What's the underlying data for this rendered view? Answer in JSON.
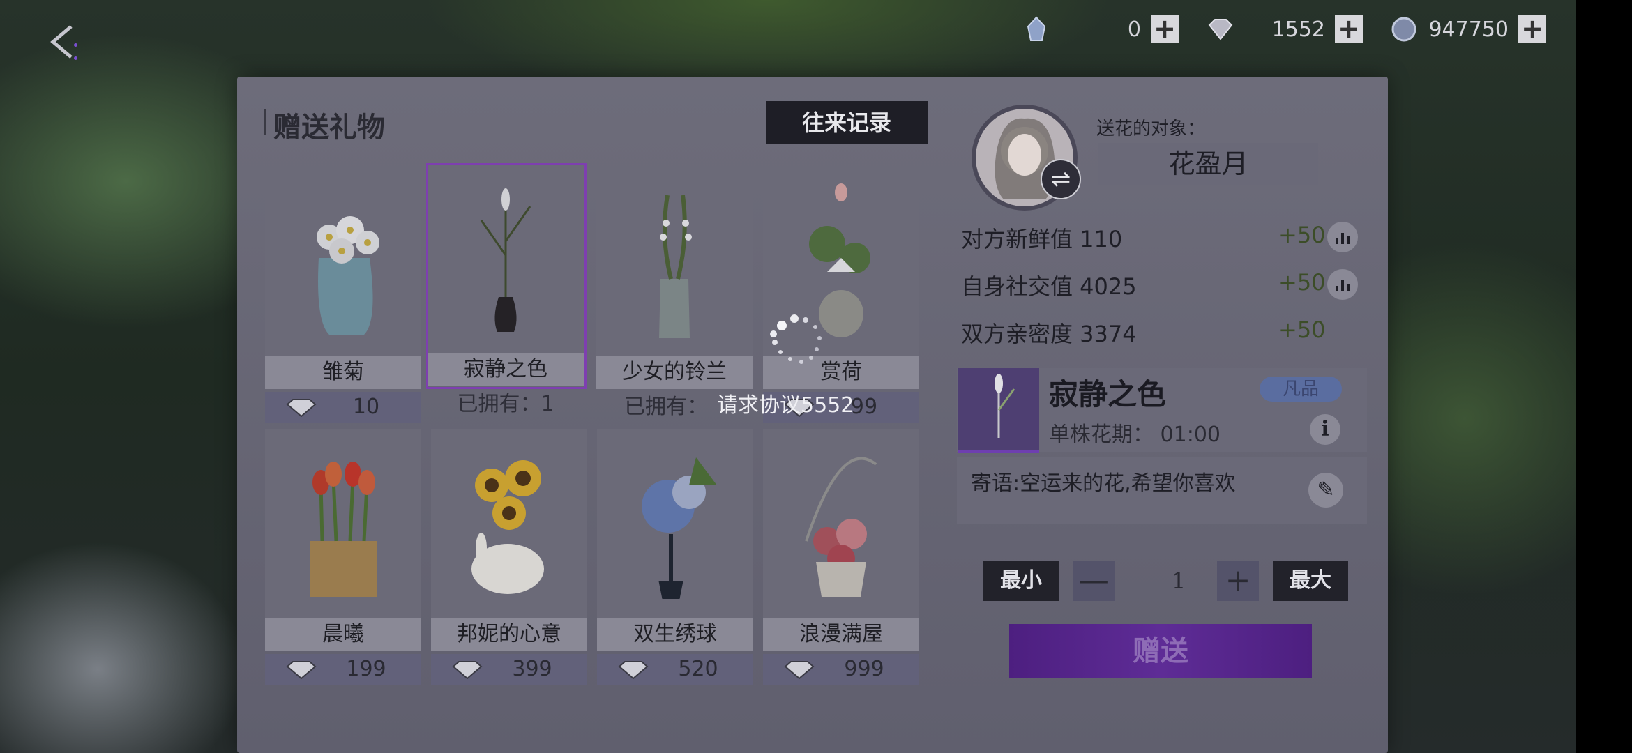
{
  "top_bar": {
    "currencies": [
      {
        "icon": "crystal-icon",
        "value": "0"
      },
      {
        "icon": "diamond-icon",
        "value": "1552"
      },
      {
        "icon": "coin-icon",
        "value": "947750"
      }
    ],
    "plus_label": "+"
  },
  "gift_panel": {
    "title": "赠送礼物",
    "history_button": "往来记录",
    "flowers": [
      {
        "name": "雏菊",
        "price": "10",
        "owned": null
      },
      {
        "name": "寂静之色",
        "price": null,
        "owned": "已拥有：1"
      },
      {
        "name": "少女的铃兰",
        "price": null,
        "owned": "已拥有："
      },
      {
        "name": "赏荷",
        "price": "99",
        "owned": null
      },
      {
        "name": "晨曦",
        "price": "199",
        "owned": null
      },
      {
        "name": "邦妮的心意",
        "price": "399",
        "owned": null
      },
      {
        "name": "双生绣球",
        "price": "520",
        "owned": null
      },
      {
        "name": "浪漫满屋",
        "price": "999",
        "owned": null
      }
    ]
  },
  "recipient": {
    "label": "送花的对象：",
    "name": "花盈月",
    "swap_icon": "⇌"
  },
  "stats": [
    {
      "label": "对方新鲜值 110",
      "bonus": "+50"
    },
    {
      "label": "自身社交值 4025",
      "bonus": "+50"
    },
    {
      "label": "双方亲密度 3374",
      "bonus": "+50"
    }
  ],
  "selected_flower": {
    "name": "寂静之色",
    "grade": "凡品",
    "period": "单株花期：  01:00",
    "info_icon": "i",
    "message": "寄语:空运来的花,希望你喜欢",
    "edit_icon": "✎"
  },
  "quantity": {
    "min_label": "最小",
    "max_label": "最大",
    "minus": "—",
    "plus": "+",
    "value": "1"
  },
  "send_button": "赠送",
  "loading": {
    "text": "请求协议5552"
  },
  "colors": {
    "accent": "#6e3fb0",
    "send": "#5e2c96",
    "bonus": "#3c4d28"
  }
}
